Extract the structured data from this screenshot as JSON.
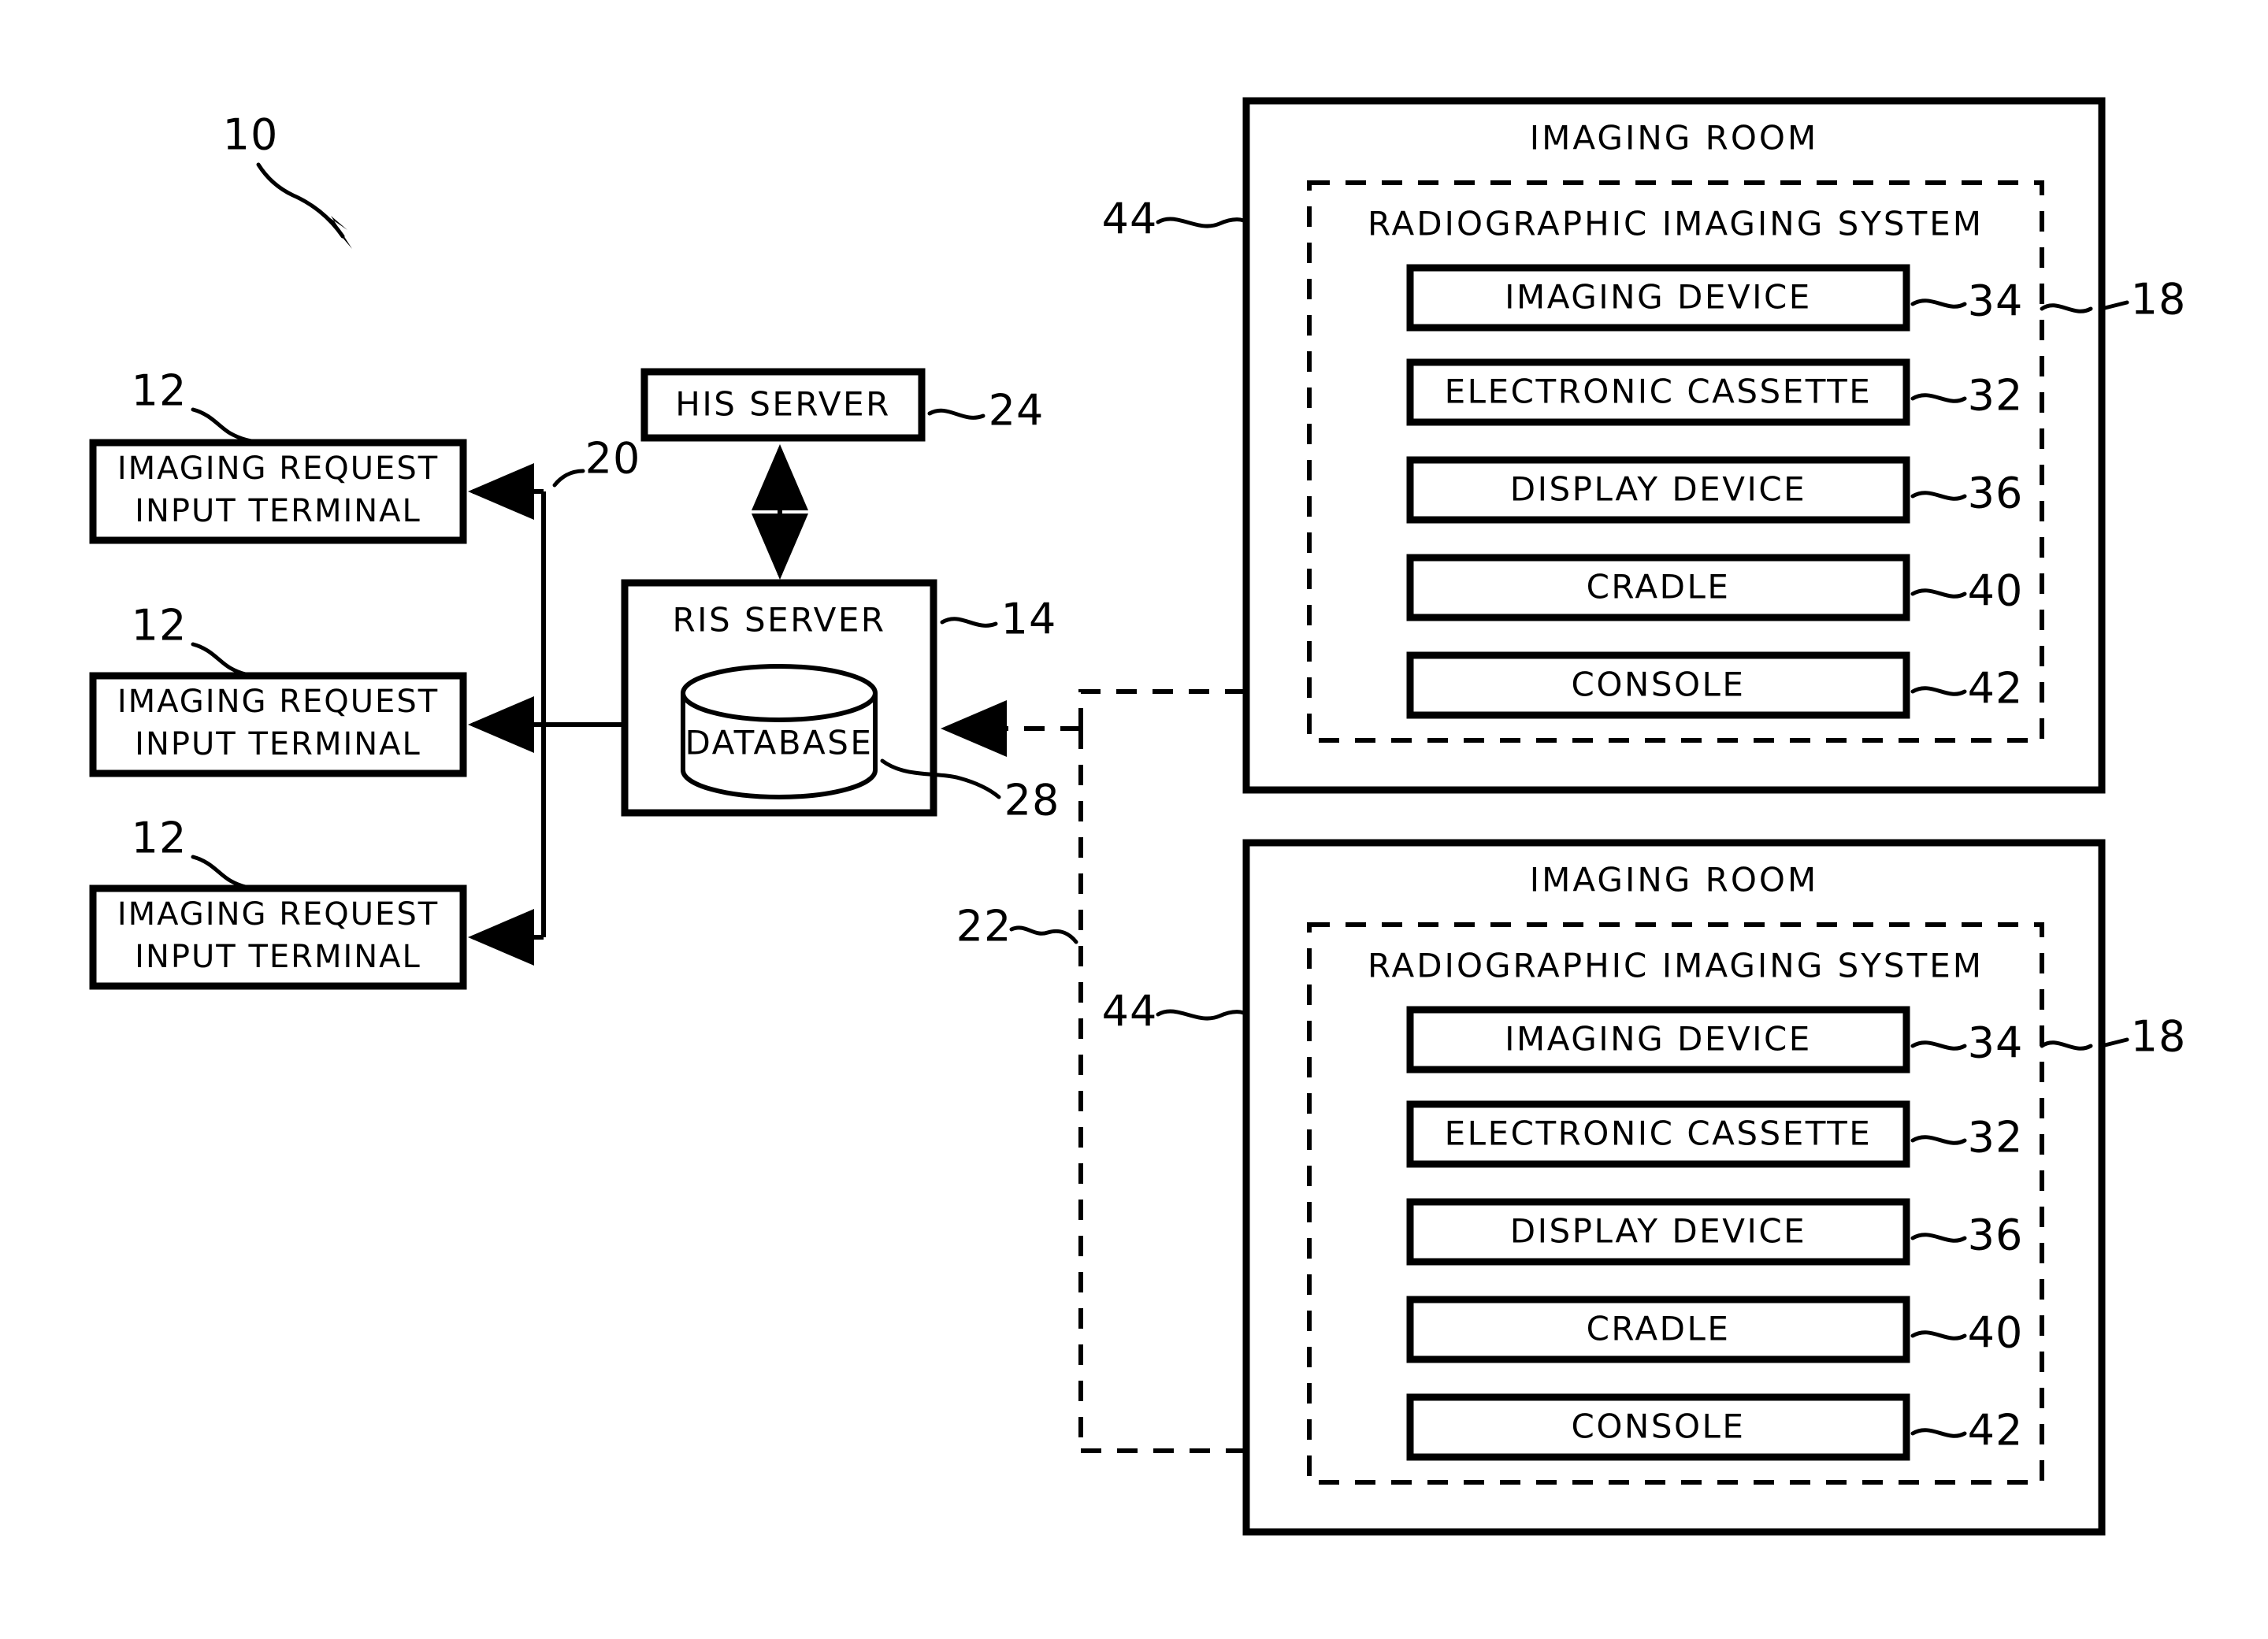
{
  "figure": {
    "system_ref": "10",
    "type": "block-diagram"
  },
  "terminals": {
    "ref": "12",
    "label_line1": "IMAGING REQUEST",
    "label_line2": "INPUT TERMINAL",
    "count": 3
  },
  "network": {
    "lan_ref": "20",
    "wireless_ref": "22"
  },
  "servers": {
    "his": {
      "label": "HIS SERVER",
      "ref": "24"
    },
    "ris": {
      "label": "RIS SERVER",
      "ref": "14"
    },
    "database": {
      "label": "DATABASE",
      "ref": "28"
    }
  },
  "rooms": [
    {
      "title": "IMAGING ROOM",
      "room_ref": "44",
      "system_title": "RADIOGRAPHIC IMAGING SYSTEM",
      "system_ref": "18",
      "devices": [
        {
          "label": "IMAGING DEVICE",
          "ref": "34"
        },
        {
          "label": "ELECTRONIC CASSETTE",
          "ref": "32"
        },
        {
          "label": "DISPLAY DEVICE",
          "ref": "36"
        },
        {
          "label": "CRADLE",
          "ref": "40"
        },
        {
          "label": "CONSOLE",
          "ref": "42"
        }
      ]
    },
    {
      "title": "IMAGING ROOM",
      "room_ref": "44",
      "system_title": "RADIOGRAPHIC IMAGING SYSTEM",
      "system_ref": "18",
      "devices": [
        {
          "label": "IMAGING DEVICE",
          "ref": "34"
        },
        {
          "label": "ELECTRONIC CASSETTE",
          "ref": "32"
        },
        {
          "label": "DISPLAY DEVICE",
          "ref": "36"
        },
        {
          "label": "CRADLE",
          "ref": "40"
        },
        {
          "label": "CONSOLE",
          "ref": "42"
        }
      ]
    }
  ],
  "colors": {
    "ink": "#000000",
    "paper": "#ffffff"
  }
}
